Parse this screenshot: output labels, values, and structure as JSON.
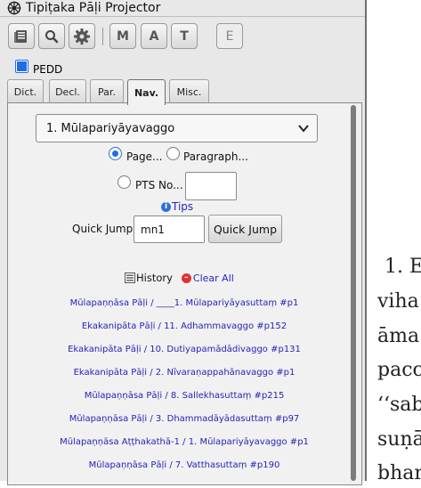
{
  "window": {
    "title": "Tipiṭaka Pāḷi Projector"
  },
  "toolbar": {
    "buttons": [
      {
        "name": "book-icon"
      },
      {
        "name": "search-icon"
      },
      {
        "name": "gear-icon"
      }
    ],
    "letters": [
      "M",
      "A",
      "T",
      "E"
    ]
  },
  "pedd": {
    "label": "PEDD",
    "checked": true
  },
  "tabs": [
    {
      "label": "Dict.",
      "active": false
    },
    {
      "label": "Decl.",
      "active": false
    },
    {
      "label": "Par.",
      "active": false
    },
    {
      "label": "Nav.",
      "active": true
    },
    {
      "label": "Misc.",
      "active": false
    }
  ],
  "nav": {
    "vagga_select": "1. Mūlapariyāyavaggo",
    "radio_page": "Page...",
    "radio_paragraph": "Paragraph...",
    "radio_pts": "PTS No...",
    "tips": "Tips",
    "quick_jump_label": "Quick Jump",
    "quick_jump_value": "mn1",
    "quick_jump_button": "Quick Jump",
    "history_label": "History",
    "clear_all": "Clear All",
    "history": [
      "Mūlapaṇṇāsa Pāḷi / ____1. Mūlapariyāyasuttaṃ #p1",
      "Ekakanipāta Pāḷi / 11. Adhammavaggo #p152",
      "Ekakanipāta Pāḷi / 10. Dutiyapamādādivaggo #p131",
      "Ekakanipāta Pāḷi / 2. Nīvaraṇappahānavaggo #p1",
      "Mūlapaṇṇāsa Pāḷi / 8. Sallekhasuttaṃ #p215",
      "Mūlapaṇṇāsa Pāḷi / 3. Dhammadāyādasuttaṃ #p97",
      "Mūlapaṇṇāsa Aṭṭhakathā-1 / 1. Mūlapariyāyavaggo #p1",
      "Mūlapaṇṇāsa Pāḷi / 7. Vatthasuttaṃ #p190"
    ]
  },
  "main_text": {
    "lines": [
      "1. E",
      "viha",
      "āma",
      "pacc",
      "‘‘sab",
      "suṇā",
      "bhar"
    ]
  }
}
